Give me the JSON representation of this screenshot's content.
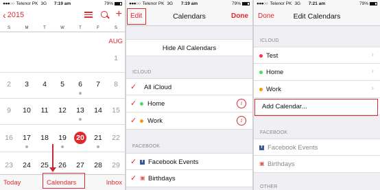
{
  "status": [
    {
      "signal": "●●●○○",
      "carrier": "Telenor PK",
      "network": "3G",
      "time": "7:19 am",
      "battery": "79%"
    },
    {
      "signal": "●●●○○",
      "carrier": "Telenor PK",
      "network": "3G",
      "time": "7:19 am",
      "battery": "79%"
    },
    {
      "signal": "●●●○○",
      "carrier": "Telenor PK",
      "network": "3G",
      "time": "7:21 am",
      "battery": "79%"
    }
  ],
  "calendar": {
    "back_label": "2015",
    "weekdays": [
      "S",
      "M",
      "T",
      "W",
      "T",
      "F",
      "S"
    ],
    "month_label": "AUG",
    "weeks": [
      [
        "",
        "",
        "",
        "",
        "",
        "",
        "1"
      ],
      [
        "2",
        "3",
        "4",
        "5",
        "6",
        "7",
        "8"
      ],
      [
        "9",
        "10",
        "11",
        "12",
        "13",
        "14",
        "15"
      ],
      [
        "16",
        "17",
        "18",
        "19",
        "20",
        "21",
        "22"
      ],
      [
        "23",
        "24",
        "25",
        "26",
        "27",
        "28",
        "29"
      ]
    ],
    "today": "20",
    "toolbar": {
      "today": "Today",
      "calendars": "Calendars",
      "inbox": "Inbox"
    }
  },
  "calendars_screen": {
    "edit": "Edit",
    "title": "Calendars",
    "done": "Done",
    "hide_all": "Hide All Calendars",
    "icloud_header": "ICLOUD",
    "all_icloud": "All iCloud",
    "home": "Home",
    "work": "Work",
    "facebook_header": "FACEBOOK",
    "facebook_events": "Facebook Events",
    "birthdays": "Birthdays",
    "home_color": "#4cd964",
    "work_color": "#ff9500"
  },
  "edit_screen": {
    "done": "Done",
    "title": "Edit Calendars",
    "icloud_header": "ICLOUD",
    "test": "Test",
    "home": "Home",
    "work": "Work",
    "add_calendar": "Add Calendar...",
    "facebook_header": "FACEBOOK",
    "facebook_events": "Facebook Events",
    "birthdays": "Birthdays",
    "other_header": "OTHER",
    "test_color": "#ff2d55",
    "home_color": "#4cd964",
    "work_color": "#ff9500"
  }
}
